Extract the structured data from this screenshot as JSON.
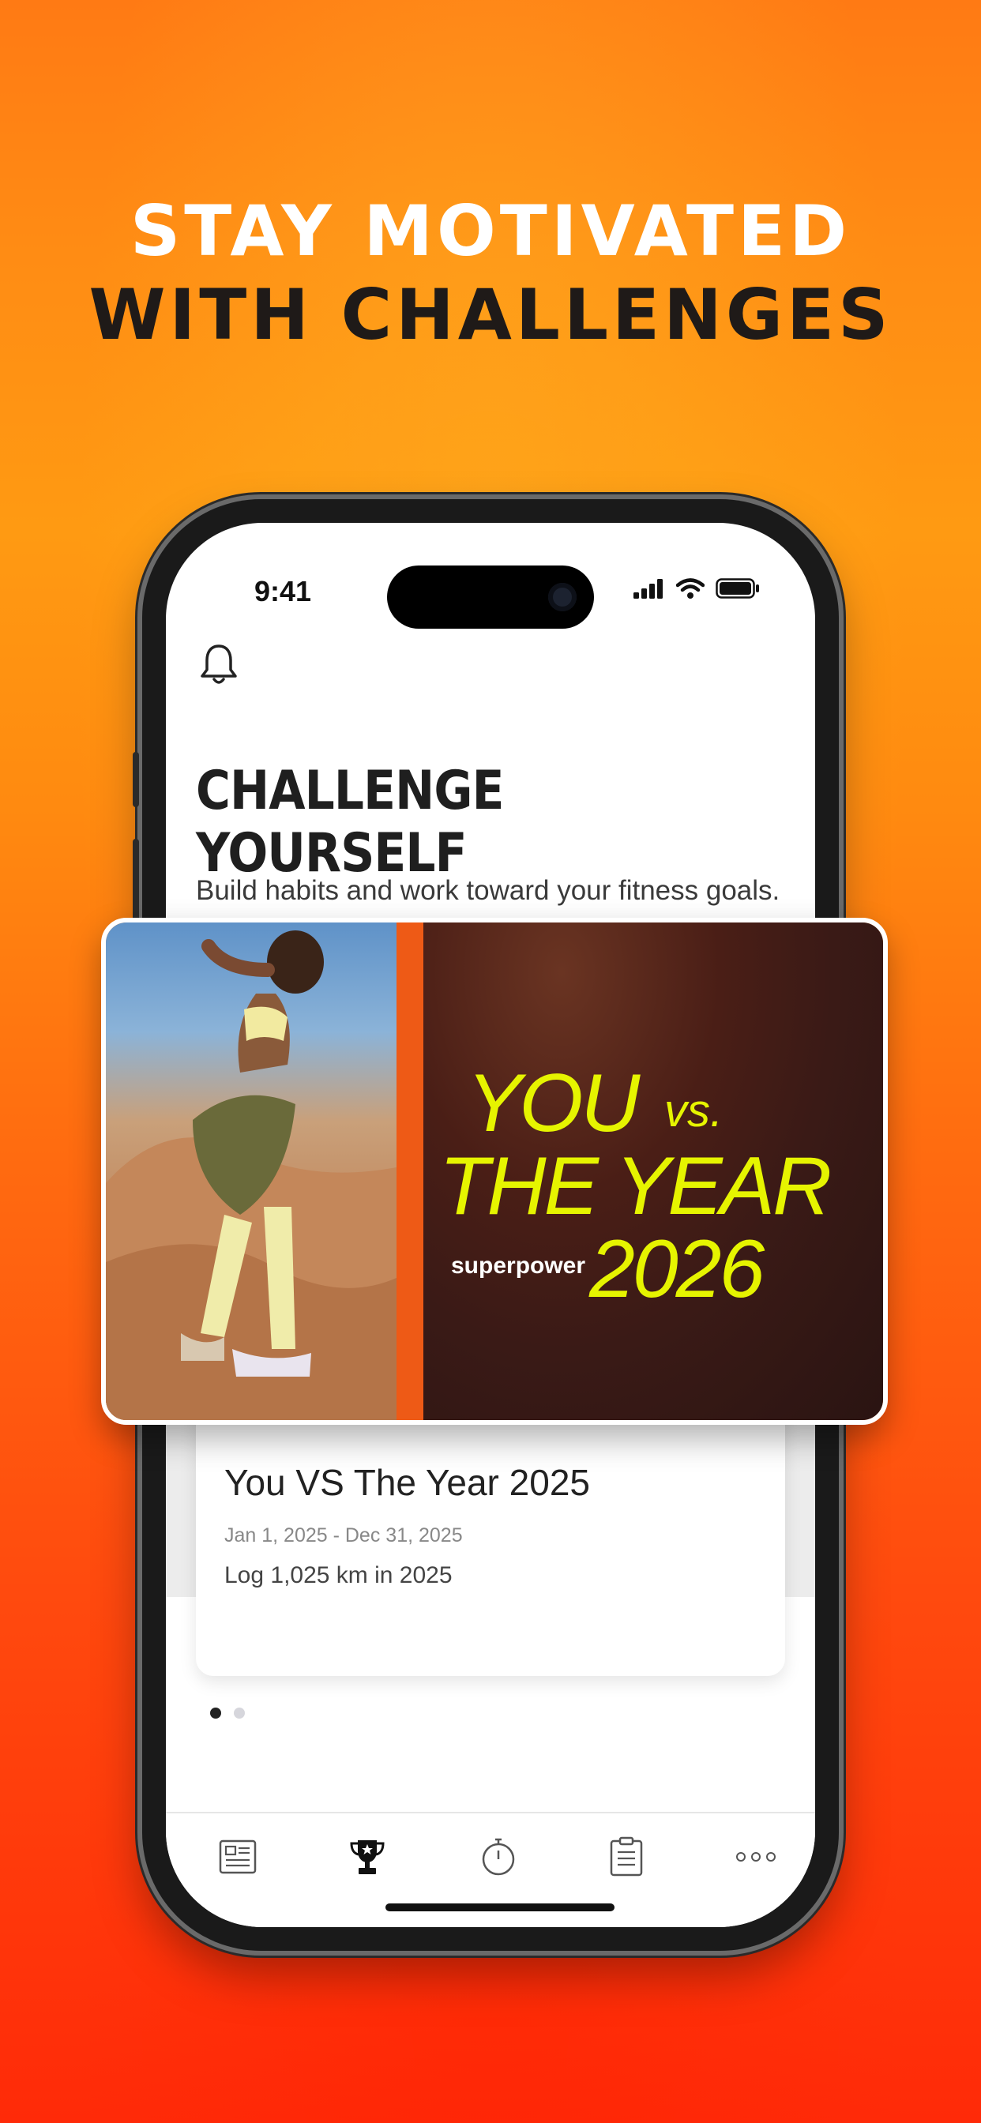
{
  "promo": {
    "headline_line1": "STAY MOTIVATED",
    "headline_line2": "WITH CHALLENGES"
  },
  "status_bar": {
    "time": "9:41"
  },
  "screen": {
    "title": "CHALLENGE YOURSELF",
    "subtitle": "Build habits and work toward your fitness goals. Compete in challenges to track your progress"
  },
  "featured_banner": {
    "you": "YOU",
    "vs": "vs.",
    "the_year": "THE YEAR",
    "year": "2026",
    "brand": "superpower"
  },
  "challenge_card": {
    "title": "You VS The Year 2025",
    "dates": "Jan 1, 2025 - Dec 31, 2025",
    "goal": "Log 1,025 km in 2025"
  },
  "pager": {
    "count": 2,
    "active_index": 0
  },
  "tabbar": {
    "items": [
      {
        "icon": "feed-icon"
      },
      {
        "icon": "trophy-icon",
        "active": true
      },
      {
        "icon": "stopwatch-icon"
      },
      {
        "icon": "clipboard-icon"
      },
      {
        "icon": "more-icon"
      }
    ]
  },
  "colors": {
    "background_top": "#ff7a14",
    "background_bottom": "#ff2a08",
    "banner_text": "#e6f400",
    "banner_stripe": "#ee5a16"
  }
}
